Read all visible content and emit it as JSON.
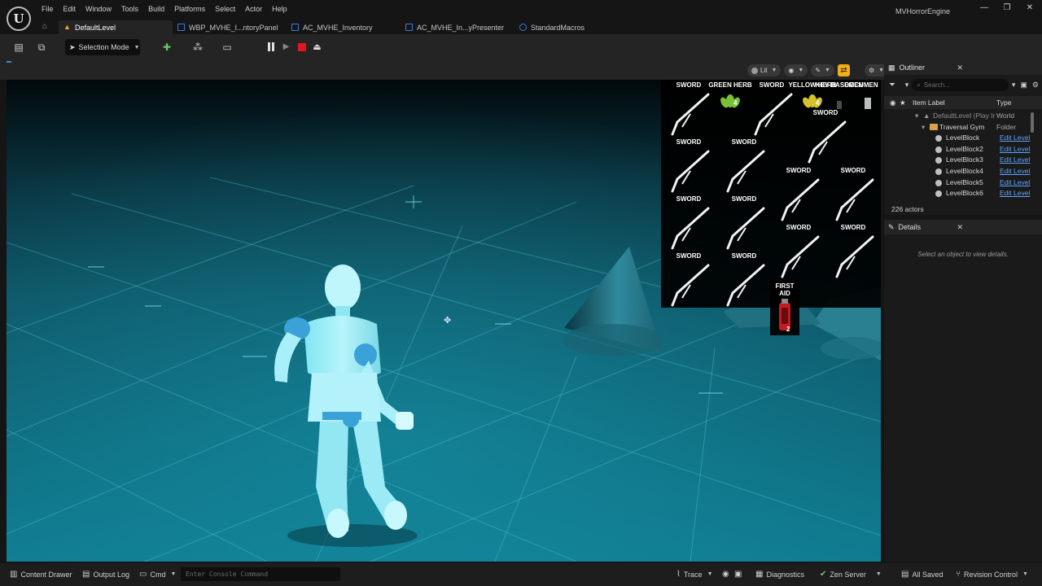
{
  "app": {
    "project_name": "MVHorrorEngine",
    "menu": [
      "File",
      "Edit",
      "Window",
      "Tools",
      "Build",
      "Platforms",
      "Select",
      "Actor",
      "Help"
    ],
    "window_controls": {
      "minimize": "—",
      "maximize": "❐",
      "close": "✕"
    }
  },
  "tabs": [
    {
      "label": "DefaultLevel",
      "icon": "level-icon",
      "active": true
    },
    {
      "label": "WBP_MVHE_I...ntoryPanel",
      "icon": "widget-blueprint-icon",
      "active": false
    },
    {
      "label": "AC_MVHE_Inventory",
      "icon": "actor-component-icon",
      "active": false
    },
    {
      "label": "AC_MVHE_In...yPresenter",
      "icon": "actor-component-icon",
      "active": false
    },
    {
      "label": "StandardMacros",
      "icon": "macro-library-icon",
      "active": false
    }
  ],
  "toolbar": {
    "selection_mode_label": "Selection Mode"
  },
  "viewport": {
    "view_mode_label": "Lit"
  },
  "inventory": {
    "items": [
      {
        "label": "SWORD"
      },
      {
        "label": "GREEN HERB",
        "count": "4"
      },
      {
        "label": "SWORD"
      },
      {
        "label": "YELLOW HERB",
        "count": "4"
      },
      {
        "label": "KEY BASEMEN"
      },
      {
        "label": "DOCUMEN"
      },
      {
        "label": "SWORD"
      },
      {
        "label": "SWORD"
      },
      {
        "label": "SWORD"
      },
      {
        "label": "SWORD"
      },
      {
        "label": "SWORD"
      },
      {
        "label": "SWORD"
      },
      {
        "label": "SWORD"
      },
      {
        "label": "SWORD"
      },
      {
        "label": "SWORD"
      },
      {
        "label": "SWORD"
      },
      {
        "label": "SWORD"
      },
      {
        "label": "SWORD"
      }
    ],
    "first_aid": {
      "label": "FIRST AID",
      "count": "2"
    }
  },
  "outliner": {
    "title": "Outliner",
    "search_placeholder": "Search...",
    "columns": {
      "label": "Item Label",
      "type": "Type"
    },
    "rows": [
      {
        "name": "DefaultLevel (Play Ir",
        "type": "World",
        "depth": 0
      },
      {
        "name": "Traversal Gym",
        "type": "Folder",
        "depth": 1
      },
      {
        "name": "LevelBlock",
        "link": "Edit Level",
        "depth": 2
      },
      {
        "name": "LevelBlock2",
        "link": "Edit Level",
        "depth": 2
      },
      {
        "name": "LevelBlock3",
        "link": "Edit Level",
        "depth": 2
      },
      {
        "name": "LevelBlock4",
        "link": "Edit Level",
        "depth": 2
      },
      {
        "name": "LevelBlock5",
        "link": "Edit Level",
        "depth": 2
      },
      {
        "name": "LevelBlock6",
        "link": "Edit Level",
        "depth": 2
      }
    ],
    "actor_count": "226 actors"
  },
  "details": {
    "title": "Details",
    "empty_text": "Select an object to view details."
  },
  "statusbar": {
    "content_drawer": "Content Drawer",
    "output_log": "Output Log",
    "cmd": "Cmd",
    "console_placeholder": "Enter Console Command",
    "trace": "Trace",
    "diagnostics": "Diagnostics",
    "zen_server": "Zen Server",
    "all_saved": "All Saved",
    "revision_control": "Revision Control"
  }
}
